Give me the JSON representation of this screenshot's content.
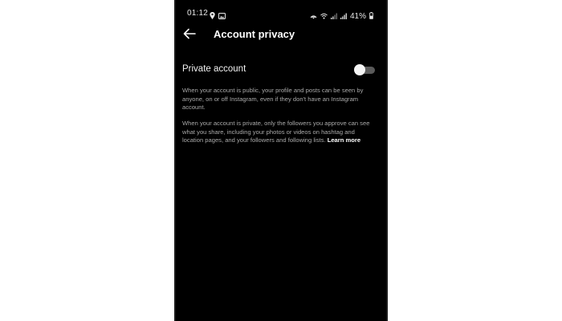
{
  "status_bar": {
    "time": "01:12",
    "battery": "41%",
    "icons": [
      "location-icon",
      "image-icon",
      "hotspot-icon",
      "wifi-icon",
      "signal-icon",
      "signal-icon",
      "battery-icon"
    ]
  },
  "header": {
    "title": "Account privacy",
    "back_icon": "back-arrow-icon"
  },
  "setting": {
    "label": "Private account",
    "toggle_on": false
  },
  "descriptions": {
    "public": "When your account is public, your profile and posts can be seen by anyone, on or off Instagram, even if they don't have an Instagram account.",
    "private": "When your account is private, only the followers you approve can see what you share, including your photos or videos on hashtag and location pages, and your followers and following lists.",
    "learn_more": "Learn more"
  },
  "colors": {
    "background": "#000000",
    "text": "#ffffff",
    "secondary_text": "#a8a8a8",
    "toggle_track": "#5a5a5a",
    "toggle_knob": "#f5f5f5"
  }
}
